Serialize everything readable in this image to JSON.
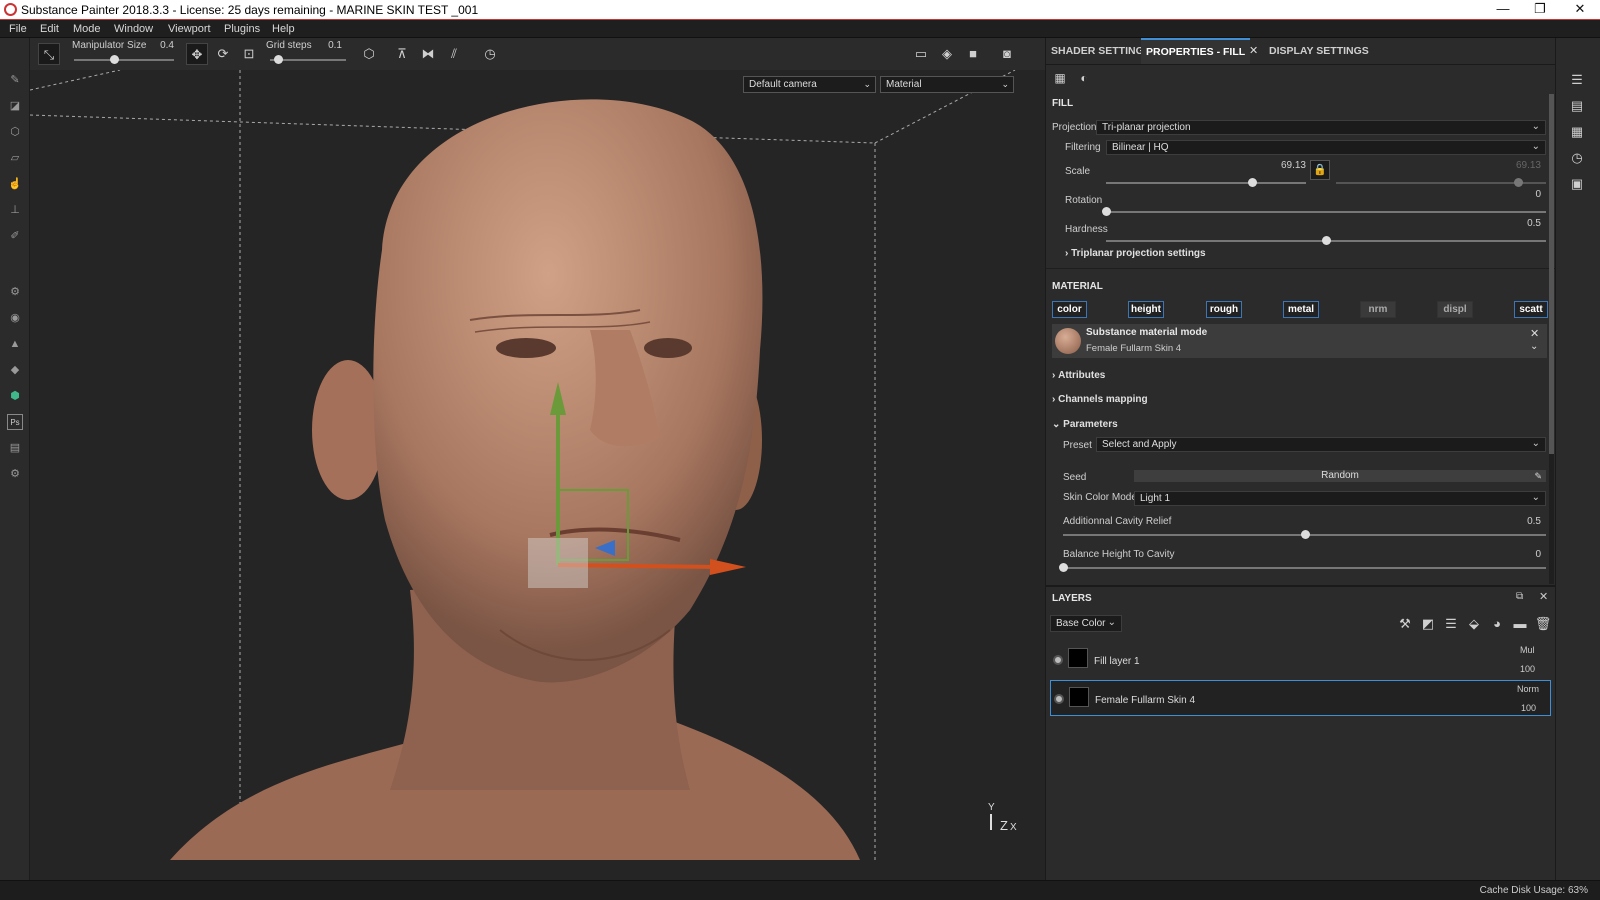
{
  "window": {
    "title": "Substance Painter 2018.3.3 - License: 25 days remaining - MARINE SKIN TEST _001",
    "minimize": "—",
    "maximize": "❐",
    "close": "✕"
  },
  "menu": [
    "File",
    "Edit",
    "Mode",
    "Window",
    "Viewport",
    "Plugins",
    "Help"
  ],
  "toolbar": {
    "manipulator_label": "Manipulator Size",
    "manipulator_value": "0.4",
    "manipulator_fraction": 0.4,
    "grid_label": "Grid steps",
    "grid_value": "0.1",
    "grid_fraction": 0.1
  },
  "viewport": {
    "camera": "Default camera",
    "mode": "Material",
    "axis_y": "Y",
    "axis_z": "Z",
    "axis_x": "X"
  },
  "tabs": {
    "shader": "SHADER SETTINGS",
    "properties": "PROPERTIES - FILL",
    "display": "DISPLAY SETTINGS",
    "close": "✕"
  },
  "fill": {
    "header": "FILL",
    "projection_label": "Projection",
    "projection_value": "Tri-planar projection",
    "filtering_label": "Filtering",
    "filtering_value": "Bilinear | HQ",
    "scale_label": "Scale",
    "scale_value": "69.13",
    "scale_value2": "69.13",
    "scale_fraction": 0.73,
    "rotation_label": "Rotation",
    "rotation_value": "0",
    "rotation_fraction": 0.0,
    "hardness_label": "Hardness",
    "hardness_value": "0.5",
    "hardness_fraction": 0.5,
    "triplanar_label": "Triplanar projection settings"
  },
  "material": {
    "header": "MATERIAL",
    "channels": [
      {
        "label": "color",
        "on": true
      },
      {
        "label": "height",
        "on": true
      },
      {
        "label": "rough",
        "on": true
      },
      {
        "label": "metal",
        "on": true
      },
      {
        "label": "nrm",
        "on": false
      },
      {
        "label": "displ",
        "on": false
      },
      {
        "label": "scatt",
        "on": true
      }
    ],
    "mode_title": "Substance material mode",
    "mode_name": "Female Fullarm Skin 4",
    "attributes": "Attributes",
    "channels_mapping": "Channels mapping",
    "parameters": "Parameters",
    "preset_label": "Preset",
    "preset_value": "Select and Apply",
    "seed_label": "Seed",
    "seed_value": "Random",
    "skin_label": "Skin Color Mode",
    "skin_value": "Light 1",
    "cavity_label": "Additionnal Cavity Relief",
    "cavity_value": "0.5",
    "cavity_fraction": 0.5,
    "balance_label": "Balance Height To Cavity",
    "balance_value": "0",
    "balance_fraction": 0.0
  },
  "layers": {
    "header": "LAYERS",
    "channel": "Base Color",
    "items": [
      {
        "name": "Fill layer 1",
        "blend": "Mul",
        "opacity": "100",
        "selected": false
      },
      {
        "name": "Female Fullarm Skin 4",
        "blend": "Norm",
        "opacity": "100",
        "selected": true
      }
    ]
  },
  "status": {
    "cache": "Cache Disk Usage:   63%"
  },
  "colors": {
    "accent": "#3f8fd6",
    "title_red": "#cc3333",
    "x_axis": "#d2501e",
    "y_axis": "#6a9a3a",
    "z_axis": "#3a6fc8"
  }
}
